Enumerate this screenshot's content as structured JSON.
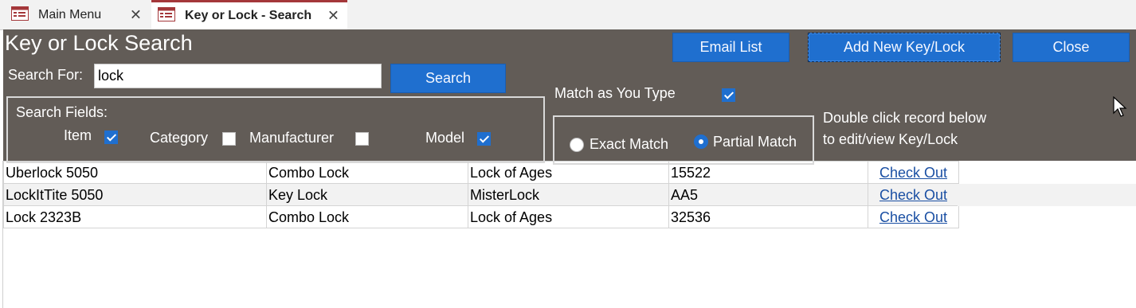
{
  "tabs": [
    {
      "label": "Main Menu",
      "icon": "form-icon",
      "active": false
    },
    {
      "label": "Key or Lock - Search",
      "icon": "form-icon",
      "active": true
    }
  ],
  "form": {
    "title": "Key or Lock Search",
    "buttons": {
      "email": "Email List",
      "add_new": "Add New Key/Lock",
      "close": "Close",
      "search": "Search"
    },
    "search_for_label": "Search For:",
    "search_value": "lock",
    "search_fields": {
      "label": "Search Fields:",
      "item": {
        "label": "Item",
        "checked": true
      },
      "category": {
        "label": "Category",
        "checked": false
      },
      "manufacturer": {
        "label": "Manufacturer",
        "checked": false
      },
      "model": {
        "label": "Model",
        "checked": true
      }
    },
    "match_as_you_type": {
      "label": "Match as You Type",
      "checked": true
    },
    "match_mode": {
      "exact_label": "Exact Match",
      "partial_label": "Partial Match",
      "selected": "partial"
    },
    "hint_line1": "Double click record below",
    "hint_line2": "to edit/view Key/Lock"
  },
  "records": [
    {
      "item": "Uberlock 5050",
      "category": "Combo Lock",
      "manufacturer": "Lock of Ages",
      "model": "15522",
      "action": "Check Out"
    },
    {
      "item": "LockItTite 5050",
      "category": "Key Lock",
      "manufacturer": "MisterLock",
      "model": "AA5",
      "action": "Check Out"
    },
    {
      "item": "Lock 2323B",
      "category": "Combo Lock",
      "manufacturer": "Lock of Ages",
      "model": "32536",
      "action": "Check Out"
    }
  ],
  "colors": {
    "header_bg": "#625c57",
    "button_blue": "#1f6fcf",
    "tab_accent": "#a4373a",
    "link": "#1a4fa3"
  }
}
